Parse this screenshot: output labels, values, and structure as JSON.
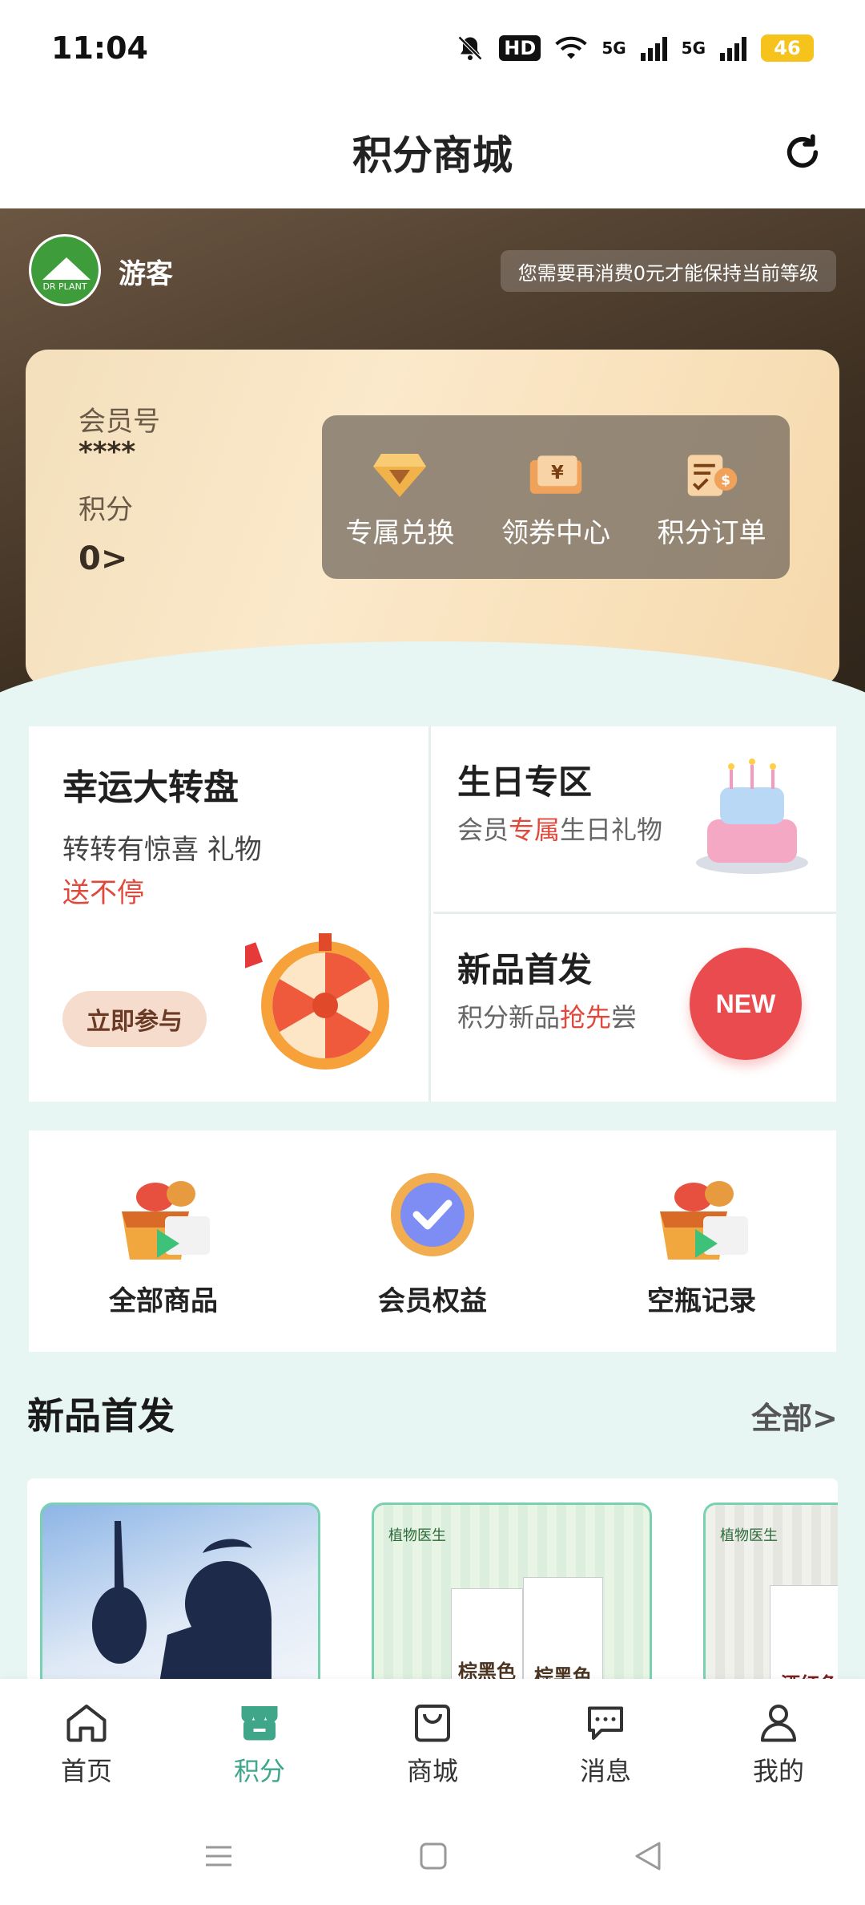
{
  "status_bar": {
    "time": "11:04",
    "hd": "HD",
    "net1": "5G",
    "net2": "5G",
    "battery": "46"
  },
  "header": {
    "title": "积分商城"
  },
  "hero": {
    "username": "游客",
    "level_note": "您需要再消费0元才能保持当前等级",
    "avatar_text": "DR PLANT",
    "member_no_label": "会员号",
    "member_no_value": "****",
    "points_label": "积分",
    "points_value": "0>",
    "quick_actions": [
      {
        "label": "专属兑换",
        "icon": "diamond-icon"
      },
      {
        "label": "领券中心",
        "icon": "coupon-icon"
      },
      {
        "label": "积分订单",
        "icon": "order-icon"
      }
    ]
  },
  "activities": {
    "lucky": {
      "title": "幸运大转盘",
      "sub_line1": "转转有惊喜 礼物",
      "sub_line2": "送不停",
      "button": "立即参与"
    },
    "birthday": {
      "title": "生日专区",
      "sub_a": "会员",
      "sub_b": "专属",
      "sub_c": "生日礼物"
    },
    "newarrival": {
      "title": "新品首发",
      "sub_a": "积分新品",
      "sub_b": "抢先",
      "sub_c": "尝",
      "badge": "NEW"
    }
  },
  "services": [
    {
      "label": "全部商品",
      "icon": "all-goods-icon"
    },
    {
      "label": "会员权益",
      "icon": "member-benefits-icon"
    },
    {
      "label": "空瓶记录",
      "icon": "empty-bottle-icon"
    }
  ],
  "section": {
    "title": "新品首发",
    "more": "全部>"
  },
  "products": [
    {
      "brand": "",
      "label": ""
    },
    {
      "brand": "植物医生",
      "label": "棕黑色"
    },
    {
      "brand": "植物医生",
      "label": "酒红色"
    }
  ],
  "tabbar": [
    {
      "label": "首页",
      "icon": "home-icon",
      "active": false
    },
    {
      "label": "积分",
      "icon": "points-shop-icon",
      "active": true
    },
    {
      "label": "商城",
      "icon": "shopping-bag-icon",
      "active": false
    },
    {
      "label": "消息",
      "icon": "message-icon",
      "active": false
    },
    {
      "label": "我的",
      "icon": "profile-icon",
      "active": false
    }
  ],
  "colors": {
    "accent": "#3fa689",
    "hero_dark": "#3e3022",
    "highlight_red": "#e0483b",
    "page_bg": "#e7f5f3"
  }
}
